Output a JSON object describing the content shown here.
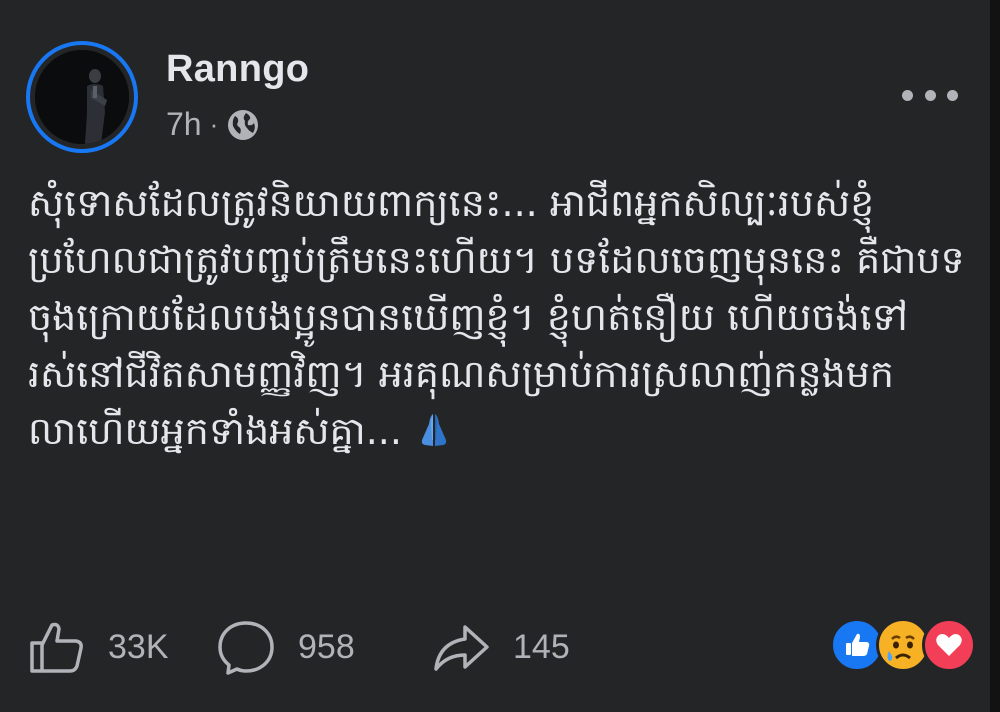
{
  "post": {
    "author": "Ranngo",
    "time": "7h",
    "separator": "·",
    "privacy_icon": "globe-icon",
    "text": "សុំទោសដែលត្រូវនិយាយពាក្យនេះ... អាជីពអ្នកសិល្បៈរបស់ខ្ញុំប្រហែលជាត្រូវបញ្ចប់ត្រឹមនេះហើយ។ បទដែលចេញមុននេះ គឺជាបទចុងក្រោយដែលបងប្អូនបានឃើញខ្ញុំ។ ខ្ញុំហត់នឿយ ហើយចង់ទៅរស់នៅជីវិតសាមញ្ញវិញ។ អរគុណសម្រាប់ការស្រលាញ់កន្លងមកលាហើយអ្នកទាំងអស់គ្នា... "
  },
  "actions": {
    "like_count": "33K",
    "comment_count": "958",
    "share_count": "145"
  },
  "reactions": [
    "like-reaction-icon",
    "sad-reaction-icon",
    "love-reaction-icon"
  ],
  "colors": {
    "background": "#242526",
    "text": "#e4e6eb",
    "secondary_text": "#b0b3b8",
    "accent": "#1877f2",
    "love": "#f33e58",
    "sad": "#f7b125"
  }
}
